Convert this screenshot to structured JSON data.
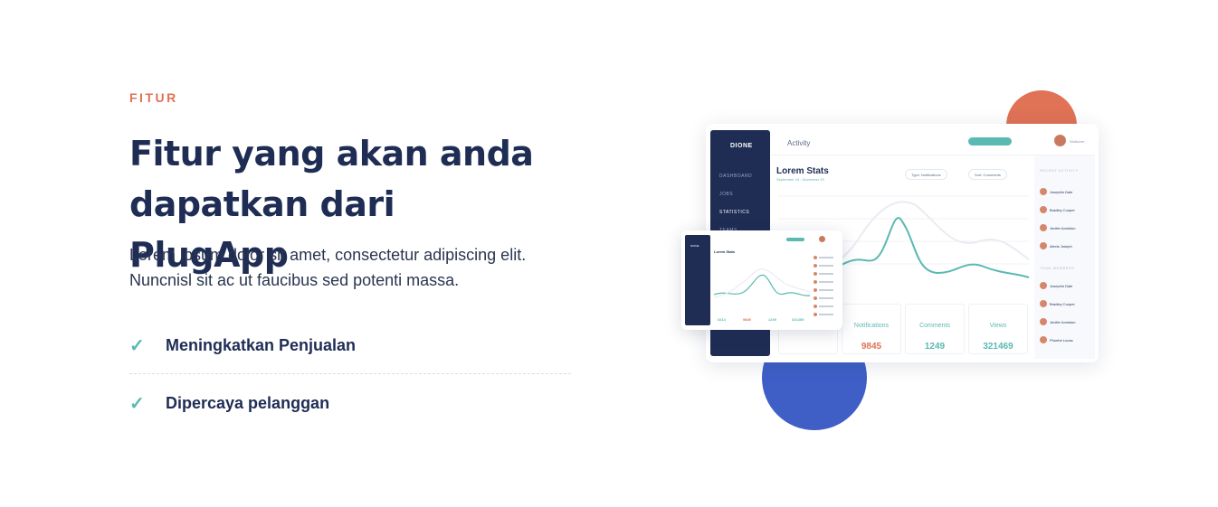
{
  "section": {
    "eyebrow": "FITUR",
    "title": "Fitur yang akan anda dapatkan dari PlugApp",
    "description": "Lorem ipsum dolor sit amet, consectetur adipiscing elit. Nuncnisl sit ac ut faucibus sed potenti massa."
  },
  "features": [
    {
      "icon": "check-icon",
      "label": "Meningkatkan Penjualan"
    },
    {
      "icon": "check-icon",
      "label": "Dipercaya pelanggan"
    }
  ],
  "colors": {
    "accent_orange": "#e07256",
    "navy": "#1f2d55",
    "teal": "#5ab9b2",
    "blue": "#3f5fc7"
  },
  "mockup": {
    "brand": "DIONE",
    "header_title": "Activity",
    "user_name": "Walkover",
    "nav": [
      "DASHBOARD",
      "JOBS",
      "STATISTICS",
      "TEAMS"
    ],
    "stats_title": "Lorem Stats",
    "stats_subtitle": "September 15 - November 29",
    "select_1": "Type: Notifications",
    "select_2": "Sort: Comments",
    "right_panel": {
      "heading_1": "RECENT ACTIVITY",
      "people_1": [
        "Josephin Dale",
        "Bradley Cooper",
        "Jenifer Anniston",
        "Alexis Joseph"
      ],
      "heading_2": "TEAM MEMBERS",
      "people_2": [
        "Josephin Dale",
        "Bradley Cooper",
        "Jenifer Anniston",
        "Phoebe Lucas"
      ]
    },
    "cards": [
      {
        "title": "",
        "value": "3214",
        "color": "#5ab9b2"
      },
      {
        "title": "Notifications",
        "value": "9845",
        "color": "#e07256"
      },
      {
        "title": "Comments",
        "value": "1249",
        "color": "#5ab9b2"
      },
      {
        "title": "Views",
        "value": "321469",
        "color": "#5ab9b2"
      }
    ],
    "phone": {
      "stats_title": "Lorem Stats",
      "values": [
        "3214",
        "9845",
        "1249",
        "321469"
      ]
    }
  }
}
